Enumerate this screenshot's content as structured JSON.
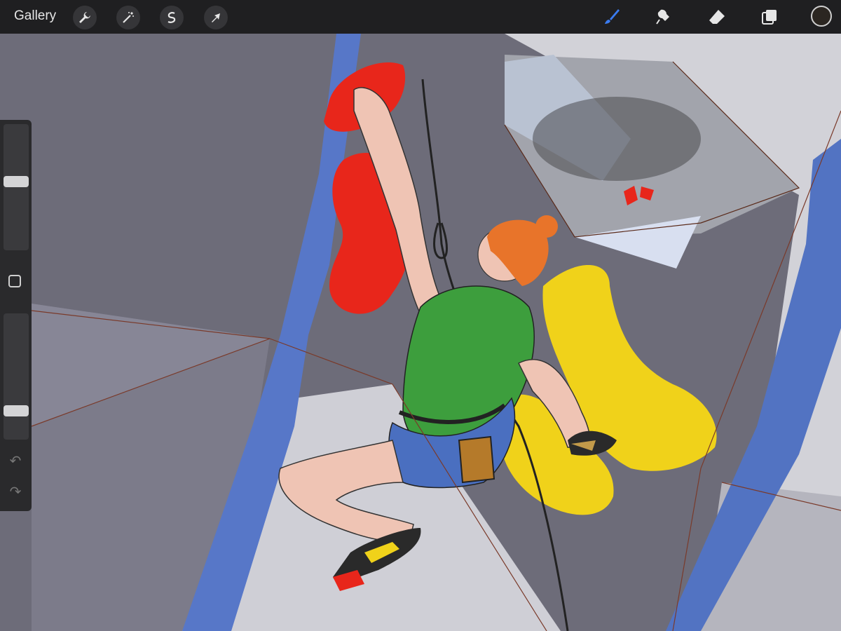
{
  "toolbar": {
    "gallery_label": "Gallery",
    "left_tools": [
      {
        "name": "wrench-icon"
      },
      {
        "name": "magic-wand-icon"
      },
      {
        "name": "selection-icon"
      },
      {
        "name": "transform-arrow-icon"
      }
    ],
    "right_tools": [
      {
        "name": "brush-icon",
        "active": true
      },
      {
        "name": "smudge-icon"
      },
      {
        "name": "eraser-icon"
      },
      {
        "name": "layers-icon"
      }
    ],
    "current_color": "#2b2621",
    "active_color": "#3a7bf0"
  },
  "sidebar": {
    "brush_size_level": 0.55,
    "opacity_level": 0.2,
    "undo_icon": "undo-icon",
    "redo_icon": "redo-icon"
  },
  "canvas": {
    "palette": {
      "wall_gray": "#6b6a78",
      "blue_strip": "#5577c8",
      "red_hold": "#e8261b",
      "yellow_hold": "#f0d21a",
      "shirt_green": "#3d9e3d",
      "hair_orange": "#e8742a",
      "skin": "#efc4b4",
      "shorts_blue": "#4a6fc0"
    }
  }
}
